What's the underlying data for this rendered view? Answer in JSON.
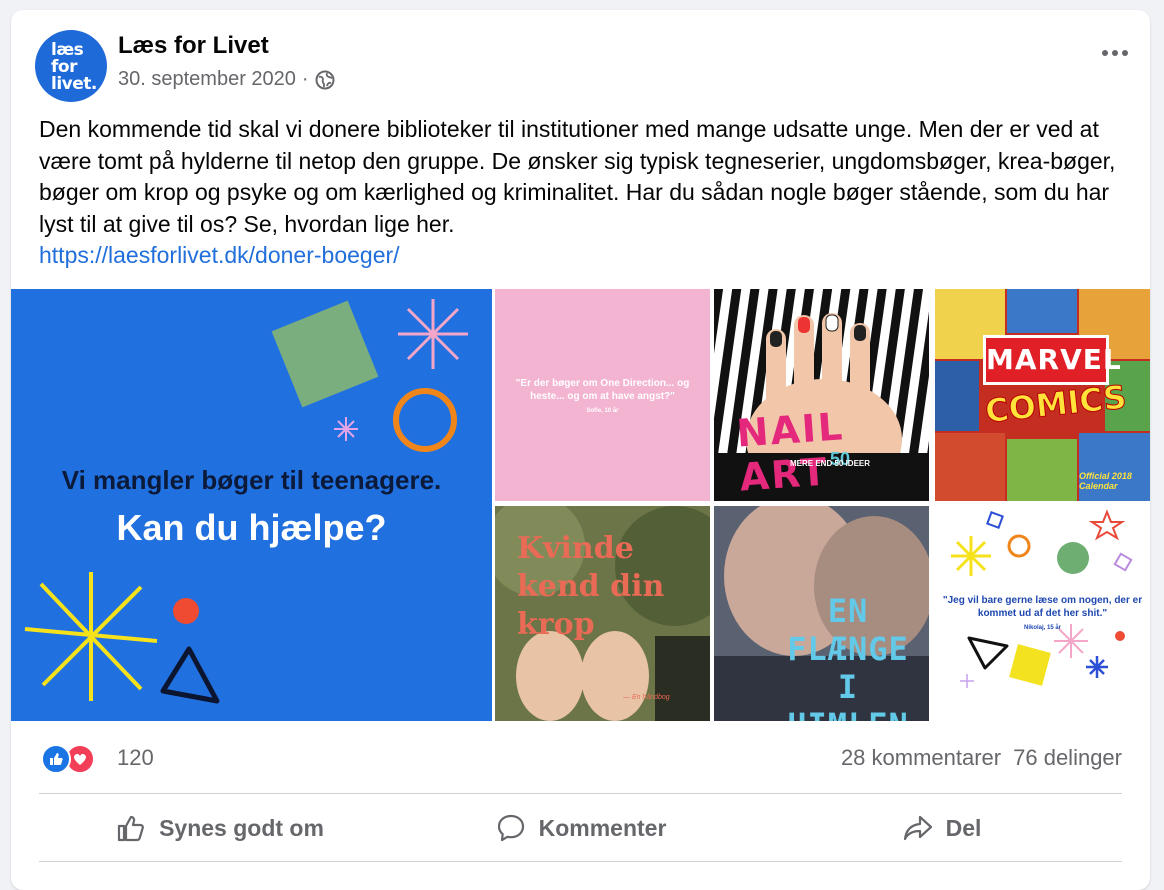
{
  "post": {
    "page_name": "Læs for Livet",
    "avatar_lines": [
      "læs",
      "for",
      "livet."
    ],
    "date": "30. september 2020",
    "separator": "·",
    "privacy_icon": "globe-icon",
    "text": "Den kommende tid skal vi donere biblioteker til institutioner med mange udsatte unge. Men der er ved at være tomt på hylderne til netop den gruppe. De ønsker sig typisk tegneserier, ungdomsbøger, krea-bøger, bøger om krop og psyke og om kærlighed og kriminalitet. Har du sådan nogle bøger stående, som du har lyst til at give til os? Se, hvordan lige her.",
    "link": "https://laesforlivet.dk/doner-boeger/",
    "colors": {
      "brand_blue": "#2170e0",
      "link": "#216fdb",
      "pink_tile": "#f3b4d2"
    }
  },
  "media": {
    "main": {
      "headline": "Vi mangler bøger til teenagere.",
      "cta": "Kan du hjælpe?"
    },
    "quote1": {
      "text": "\"Er der bøger om One Direction... og heste... og om at have angst?\"",
      "author": "Sofie, 10 år"
    },
    "nail": {
      "title": "NAIL ART",
      "number": "50",
      "subtitle": "MERE END 50 IDEER"
    },
    "marvel": {
      "logo": "MARVEL",
      "comics": "COMICS",
      "calendar": "Official 2018 Calendar"
    },
    "kvinde": {
      "title": "Kvinde kend din krop",
      "subtitle": "— En håndbog"
    },
    "flaenge": {
      "title": "EN FLÆNGE I HIMLEN"
    },
    "quote2": {
      "text": "\"Jeg vil bare gerne læse om nogen, der er kommet ud af det her shit.\"",
      "author": "Nikolaj, 15 år"
    }
  },
  "stats": {
    "reactions": [
      "like-icon",
      "love-icon"
    ],
    "reaction_count": "120",
    "comments": "28 kommentarer",
    "shares": "76 delinger"
  },
  "actions": {
    "like": "Synes godt om",
    "comment": "Kommenter",
    "share": "Del"
  }
}
